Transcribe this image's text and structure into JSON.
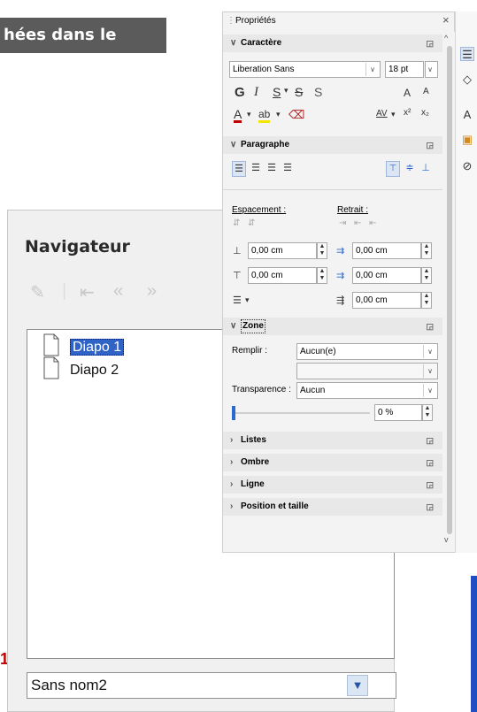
{
  "background": {
    "heading_fragment": "hées dans le",
    "red_fragment": "1"
  },
  "navigator": {
    "title": "Navigateur",
    "toolbar_icons": [
      "pen-icon",
      "first-page-icon",
      "previous-page-icon",
      "next-page-icon"
    ],
    "items": [
      {
        "label": "Diapo 1",
        "selected": true
      },
      {
        "label": "Diapo 2",
        "selected": false
      }
    ],
    "document_select": "Sans nom2"
  },
  "properties": {
    "title": "Propriétés",
    "close": "×",
    "sections": {
      "caractere": "Caractère",
      "paragraphe": "Paragraphe",
      "zone": "Zone",
      "listes": "Listes",
      "ombre": "Ombre",
      "ligne": "Ligne",
      "position": "Position et taille"
    },
    "font_name": "Liberation Sans",
    "font_size": "18 pt",
    "format_buttons": {
      "bold": "G",
      "italic": "I",
      "underline": "S",
      "strike": "S",
      "shadow": "S"
    },
    "grow_font": "A",
    "shrink_font": "A",
    "font_color": "A",
    "char_spacing": "AV",
    "superscript": "x²",
    "subscript": "x₂",
    "espacement_label": "Espacement :",
    "retrait_label": "Retrait :",
    "spacing_above": "0,00 cm",
    "spacing_below": "0,00 cm",
    "indent_before": "0,00 cm",
    "indent_after": "0,00 cm",
    "first_line_indent": "0,00 cm",
    "remplir_label": "Remplir :",
    "remplir_value": "Aucun(e)",
    "transparence_label": "Transparence :",
    "transparence_value": "Aucun",
    "transparence_percent": "0 %"
  },
  "colors": {
    "selection": "#2f63c6",
    "heading_bg": "#5b5b5b",
    "accent_blue": "#1f4fc0"
  }
}
